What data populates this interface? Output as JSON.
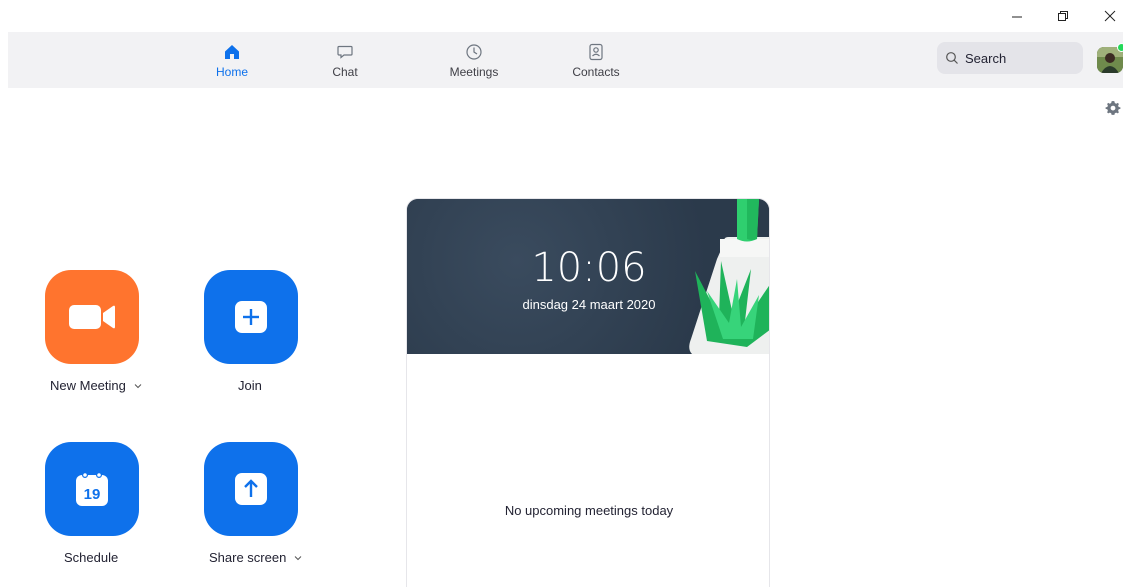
{
  "window": {
    "controls": {
      "minimize_icon": "minimize-icon",
      "maximize_icon": "restore-icon",
      "close_icon": "close-icon"
    }
  },
  "nav": {
    "tabs": [
      {
        "label": "Home",
        "icon": "home-icon",
        "active": true
      },
      {
        "label": "Chat",
        "icon": "chat-bubble-icon",
        "active": false
      },
      {
        "label": "Meetings",
        "icon": "clock-icon",
        "active": false
      },
      {
        "label": "Contacts",
        "icon": "contact-card-icon",
        "active": false
      }
    ],
    "search": {
      "placeholder": "Search",
      "icon": "search-icon"
    },
    "presence_status_color": "#23d959"
  },
  "actions": {
    "new_meeting": {
      "label": "New Meeting",
      "icon": "video-camera-icon",
      "color": "#ff742e"
    },
    "join": {
      "label": "Join",
      "icon": "plus-icon",
      "color": "#0e71eb"
    },
    "schedule": {
      "label": "Schedule",
      "icon": "calendar-icon",
      "calendar_day": "19",
      "color": "#0e71eb"
    },
    "share_screen": {
      "label": "Share screen",
      "icon": "upload-arrow-icon",
      "color": "#0e71eb"
    }
  },
  "card": {
    "time": "10:06",
    "date": "dinsdag 24 maart 2020",
    "empty_message": "No upcoming meetings today"
  },
  "colors": {
    "accent": "#0e71eb",
    "orange": "#ff742e",
    "nav_bg": "#f2f2f4",
    "card_header_bg": "#2f3f51"
  }
}
